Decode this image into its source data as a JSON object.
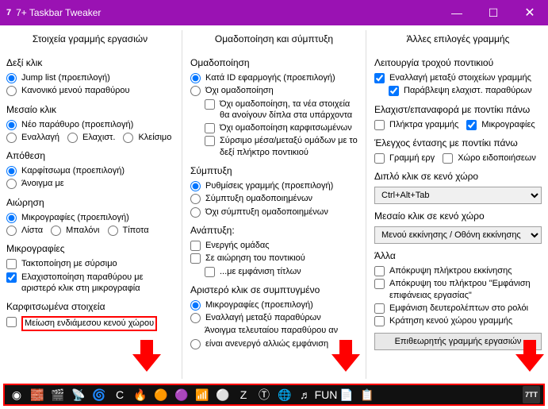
{
  "window": {
    "title": "7+ Taskbar Tweaker",
    "min": "—",
    "max": "☐",
    "close": "✕"
  },
  "col1": {
    "header": "Στοιχεία γραμμής εργασιών",
    "rightclick": {
      "title": "Δεξί κλικ",
      "o1": "Jump list (προεπιλογή)",
      "o2": "Κανονικό μενού παραθύρου"
    },
    "middleclick": {
      "title": "Μεσαίο κλικ",
      "o1": "Νέο παράθυρο (προεπιλογή)",
      "o2": "Εναλλαγή",
      "o3": "Ελαχιστ.",
      "o4": "Κλείσιμο"
    },
    "drop": {
      "title": "Απόθεση",
      "o1": "Καρφίτσωμα (προεπιλογή)",
      "o2": "Άνοιγμα με"
    },
    "hover": {
      "title": "Αιώρηση",
      "o1": "Μικρογραφίες (προεπιλογή)",
      "o2": "Λίστα",
      "o3": "Μπαλόνι",
      "o4": "Τίποτα"
    },
    "thumbs": {
      "title": "Μικρογραφίες",
      "c1": "Τακτοποίηση με σύρσιμο",
      "c2": "Ελαχιστοποίηση παραθύρου με αριστερό κλικ στη μικρογραφία"
    },
    "pinned": {
      "title": "Καρφιτσωμένα στοιχεία",
      "c1": "Μείωση ενδιάμεσου κενού χώρου"
    }
  },
  "col2": {
    "header": "Ομαδοποίηση και σύμπτυξη",
    "group": {
      "title": "Ομαδοποίηση",
      "o1": "Κατά ID εφαρμογής (προεπιλογή)",
      "o2": "Όχι ομαδοποίηση",
      "c1": "Όχι ομαδοποίηση, τα νέα στοιχεία θα ανοίγουν δίπλα στα υπάρχοντα",
      "c2": "Όχι ομαδοποίηση καρφιτσωμένων",
      "c3": "Σύρσιμο μέσα/μεταξύ ομάδων με το δεξί πλήκτρο ποντικιού"
    },
    "combine": {
      "title": "Σύμπτυξη",
      "o1": "Ρυθμίσεις γραμμής (προεπιλογή)",
      "o2": "Σύμπτυξη ομαδοποιημένων",
      "o3": "Όχι σύμπτυξη ομαδοποιημένων"
    },
    "dev": {
      "title": "Ανάπτυξη:",
      "c1": "Ενεργής ομάδας",
      "c2": "Σε αιώρηση του ποντικιού",
      "c3": "...με εμφάνιση τίτλων"
    },
    "leftclick": {
      "title": "Αριστερό κλικ σε συμπτυγμένο",
      "o1": "Μικρογραφίες (προεπιλογή)",
      "o2": "Εναλλαγή μεταξύ παραθύρων",
      "o3a": "Άνοιγμα τελευταίου παραθύρου αν",
      "o3b": "είναι ανενεργό αλλιώς εμφάνιση"
    }
  },
  "col3": {
    "header": "Άλλες επιλογές γραμμής",
    "wheel": {
      "title": "Λειτουργία τροχού ποντικιού",
      "c1": "Εναλλαγή μεταξύ στοιχείων γραμμής",
      "c2": "Παράβλεψη ελαχιστ. παραθύρων"
    },
    "minrestore": {
      "title": "Ελαχιστ/επαναφορά με ποντίκι πάνω",
      "c1": "Πλήκτρα γραμμής",
      "c2": "Μικρογραφίες"
    },
    "volume": {
      "title": "Έλεγχος έντασης με ποντίκι πάνω",
      "c1": "Γραμμή εργ",
      "c2": "Χώρο ειδοποιήσεων"
    },
    "dblclick": {
      "title": "Διπλό κλικ σε κενό χώρο",
      "value": "Ctrl+Alt+Tab"
    },
    "mclick": {
      "title": "Μεσαίο κλικ σε κενό χώρο",
      "value": "Μενού εκκίνησης / Οθόνη εκκίνησης"
    },
    "other": {
      "title": "Άλλα",
      "c1": "Απόκρυψη πλήκτρου εκκίνησης",
      "c2": "Απόκρυψη του πλήκτρου \"Εμφάνιση επιφάνειας εργασίας\"",
      "c3": "Εμφάνιση δευτερολέπτων στο ρολόι",
      "c4": "Κράτηση κενού χώρου γραμμής"
    },
    "inspector": "Επιθεωρητής γραμμής εργασιών"
  },
  "taskbar_icons": [
    "◉",
    "🧱",
    "🎬",
    "📡",
    "🌀",
    "C",
    "🔥",
    "🟠",
    "🟣",
    "📶",
    "⚪",
    "Z",
    "Ⓣ",
    "🌐",
    "♬",
    "FUN",
    "📄",
    "📋",
    "7TT"
  ]
}
